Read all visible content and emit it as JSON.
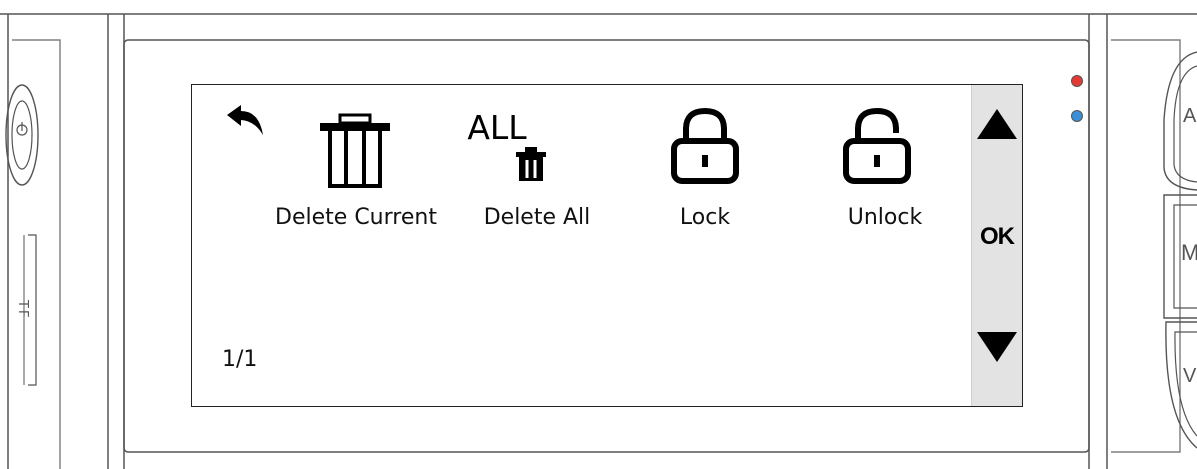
{
  "screen": {
    "page_indicator": "1/1",
    "menu_items": [
      {
        "label": "Delete Current",
        "icon": "trash-icon"
      },
      {
        "label": "Delete All",
        "icon": "trash-all-icon",
        "icon_text": "ALL"
      },
      {
        "label": "Lock",
        "icon": "lock-closed-icon"
      },
      {
        "label": "Unlock",
        "icon": "lock-open-icon"
      }
    ],
    "side_panel": {
      "up_icon": "triangle-up-icon",
      "ok_label": "OK",
      "down_icon": "triangle-down-icon"
    },
    "back_icon": "back-arrow-icon"
  },
  "device": {
    "tf_slot_label": "TF",
    "led_colors": {
      "red": "#e53935",
      "blue": "#3b8fd9"
    },
    "right_buttons": [
      "A",
      "M",
      "V"
    ]
  }
}
